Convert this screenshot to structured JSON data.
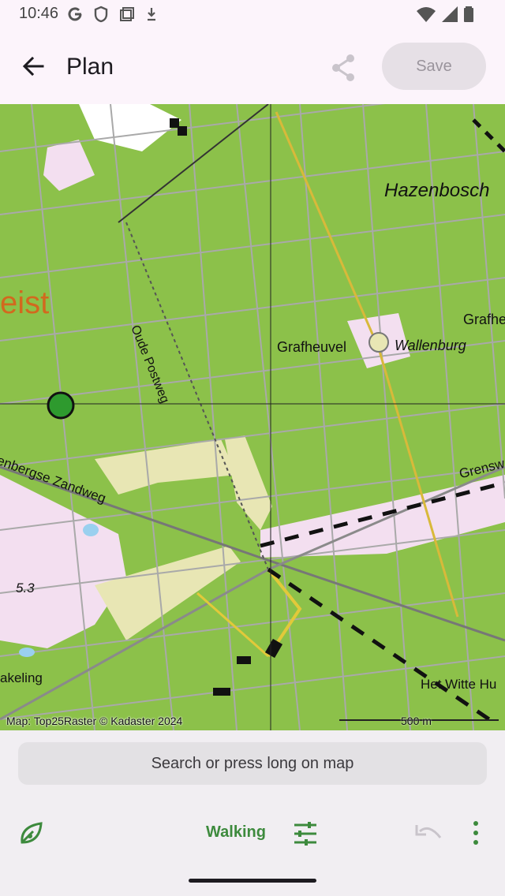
{
  "status_bar": {
    "time": "10:46",
    "icons_left": [
      "google-icon",
      "shield-icon",
      "screenshot-icon",
      "download-icon"
    ],
    "icons_right": [
      "wifi-icon",
      "signal-icon",
      "battery-icon"
    ]
  },
  "app_bar": {
    "back_icon": "arrow-back-icon",
    "title": "Plan",
    "share_icon": "share-icon",
    "save_label": "Save"
  },
  "map": {
    "labels": {
      "hazenbosch": "Hazenbosch",
      "grafhe": "Grafhe",
      "grafheuvel": "Grafheuvel",
      "wallenburg": "Wallenburg",
      "eist": "eist",
      "oude_postweg": "Oude Postweg",
      "zandweg": "enbergse Zandweg",
      "grensw": "Grensw",
      "elevation": "5.3",
      "akeling": "akeling",
      "het_witte_hu": "Het Witte Hu"
    },
    "attribution": "Map: Top25Raster © Kadaster 2024",
    "scale_label": "500 m",
    "colors": {
      "forest": "#8cc14a",
      "heath": "#f3dff0",
      "sand": "#e8e6b4",
      "road": "#a9a9a9",
      "location_marker": "#2e9a2e"
    }
  },
  "search": {
    "placeholder": "Search or press long on map"
  },
  "toolbar": {
    "route_icon": "route-icon",
    "mode_label": "Walking",
    "tune_icon": "tune-icon",
    "undo_icon": "undo-icon",
    "more_icon": "more-vert-icon"
  },
  "theme": {
    "accent": "#3d8a3d",
    "surface": "#fcf4fb",
    "bottom_surface": "#f1eef2"
  }
}
